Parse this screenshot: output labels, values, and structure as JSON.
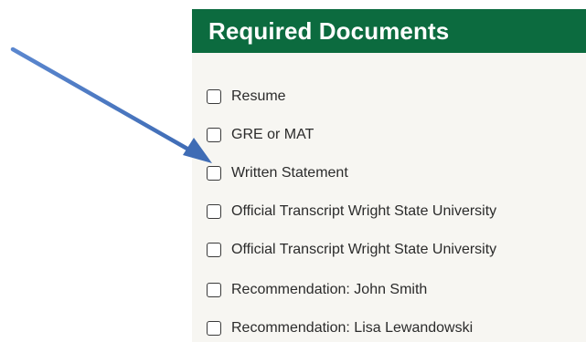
{
  "panel": {
    "title": "Required Documents",
    "header_color": "#0c6b3f",
    "documents": [
      {
        "label": "Resume",
        "checked": false
      },
      {
        "label": "GRE or MAT",
        "checked": false
      },
      {
        "label": "Written Statement",
        "checked": false
      },
      {
        "label": "Official Transcript Wright State University",
        "checked": false
      },
      {
        "label": "Official Transcript Wright State University",
        "checked": false
      },
      {
        "label": "Recommendation: John Smith",
        "checked": false
      },
      {
        "label": "Recommendation: Lisa Lewandowski",
        "checked": false
      }
    ]
  },
  "annotation": {
    "icon": "arrow-icon",
    "color": "#4a78c2",
    "points_to": "Written Statement"
  }
}
